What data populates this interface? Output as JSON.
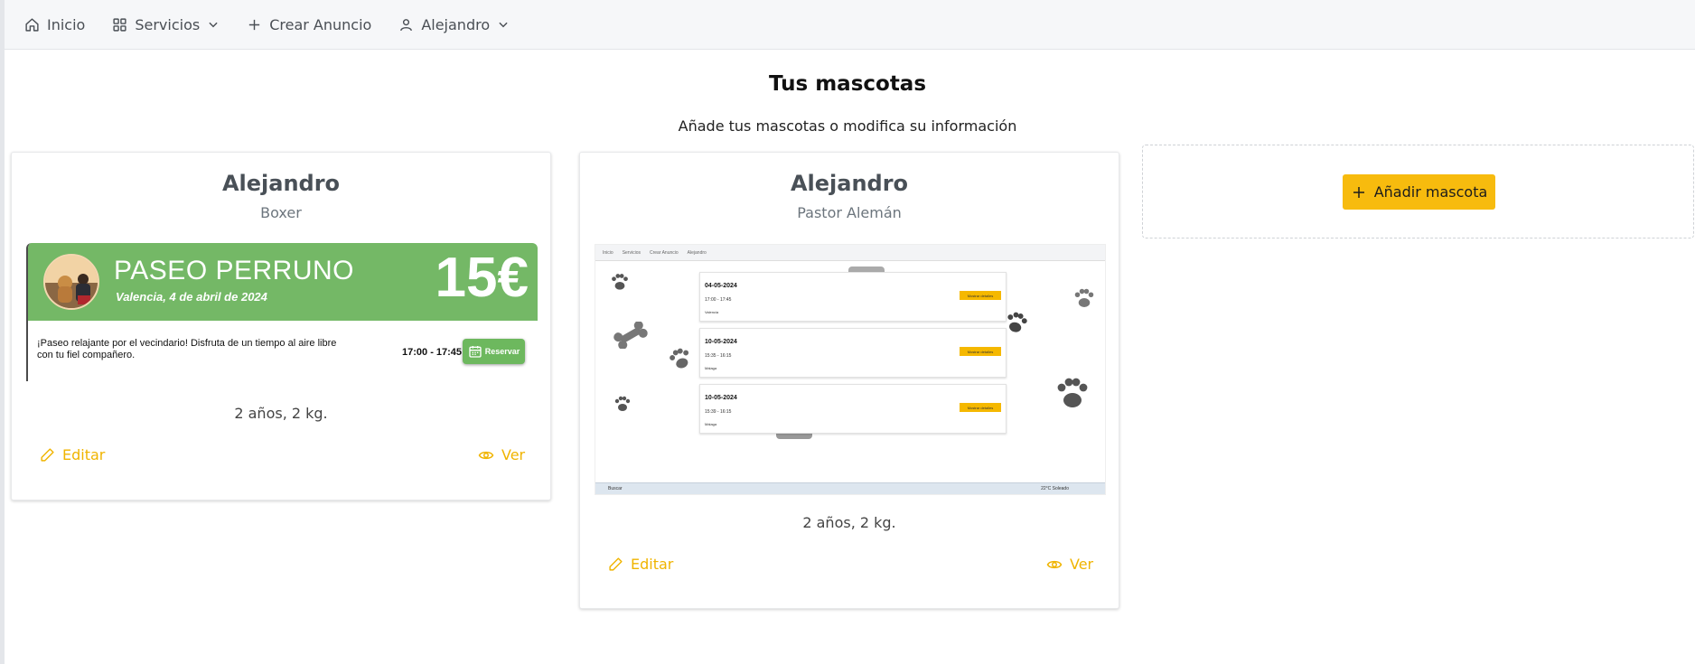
{
  "nav": {
    "home_label": "Inicio",
    "services_label": "Servicios",
    "create_ad_label": "Crear Anuncio",
    "user_label": "Alejandro"
  },
  "page": {
    "title": "Tus mascotas",
    "subtitle": "Añade tus mascotas o modifica su información"
  },
  "pets": [
    {
      "name": "Alejandro",
      "breed": "Boxer",
      "info": "2 años, 2 kg.",
      "edit_label": "Editar",
      "view_label": "Ver",
      "photo": {
        "title": "PASEO PERRUNO",
        "date": "Valencia, 4 de abril de 2024",
        "price": "15€",
        "description": "¡Paseo relajante por el vecindario! Disfruta de un tiempo al aire libre con tu fiel compañero.",
        "time": "17:00 - 17:45",
        "reserve_label": "Reservar"
      }
    },
    {
      "name": "Alejandro",
      "breed": "Pastor Alemán",
      "info": "2 años, 2 kg.",
      "edit_label": "Editar",
      "view_label": "Ver",
      "photo": {
        "nav": [
          "Inicio",
          "Servicios",
          "Crear Anuncio",
          "Alejandro"
        ],
        "entries": [
          {
            "date": "04-05-2024",
            "time": "17:00 - 17:45",
            "city": "Valencia",
            "button": "Mostrar detalles"
          },
          {
            "date": "10-05-2024",
            "time": "15:35 - 16:15",
            "city": "Málaga",
            "button": "Mostrar detalles"
          },
          {
            "date": "10-05-2024",
            "time": "15:39 - 16:15",
            "city": "Málaga",
            "button": "Mostrar detalles"
          }
        ],
        "taskbar_search": "Buscar",
        "taskbar_weather": "22°C Soleado"
      }
    }
  ],
  "add_pet": {
    "label": "Añadir mascota"
  },
  "colors": {
    "accent": "#f7bb0e",
    "link": "#f0b400",
    "ad_green": "#74b866"
  }
}
